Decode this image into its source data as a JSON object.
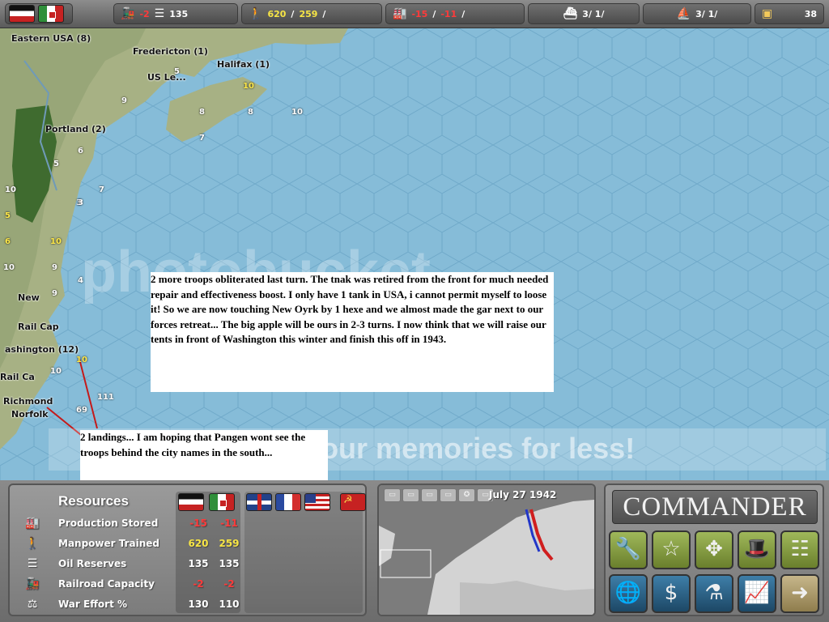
{
  "topbar": {
    "flags": [
      "germany-flag",
      "italy-flag"
    ],
    "railroad": {
      "icon": "train-icon",
      "value": "-2"
    },
    "oil": {
      "icon": "oil-barrels-icon",
      "value": "135"
    },
    "manpower": {
      "icon": "soldiers-icon",
      "axis": "620",
      "allies": "259",
      "sep": "/"
    },
    "production": {
      "icon": "factory-icon",
      "axis": "-15",
      "allies": "-11",
      "sep": "/"
    },
    "naval": {
      "icon": "battleship-icon",
      "text": "3/ 1/"
    },
    "transport": {
      "icon": "transport-ship-icon",
      "text": "3/ 1/"
    },
    "gold": {
      "icon": "treasure-chest-icon",
      "value": "38"
    }
  },
  "map": {
    "cities": [
      {
        "name": "Eastern USA (8)"
      },
      {
        "name": "Fredericton (1)"
      },
      {
        "name": "US Le..."
      },
      {
        "name": "Halifax (1)"
      },
      {
        "name": "Portland (2)"
      },
      {
        "name": "New"
      },
      {
        "name": "Rail Cap"
      },
      {
        "name": "ashington (12)"
      },
      {
        "name": "Rail Ca"
      },
      {
        "name": "Richmond"
      },
      {
        "name": "Norfolk"
      }
    ],
    "unit_numbers": [
      "9",
      "5",
      "10",
      "8",
      "7",
      "8",
      "6",
      "5",
      "7",
      "3",
      "10",
      "5",
      "10",
      "6",
      "9",
      "10",
      "10",
      "4",
      "9",
      "10",
      "10",
      "111",
      "69",
      "3"
    ],
    "watermark": "photobucket",
    "watermark_slogan": "Protect more of your memories for less!"
  },
  "notes": {
    "main": "2 more troops obliterated last turn. The tnak was retired from the front for much needed repair and effectiveness boost. I only have 1 tank in USA, i cannot permit myself to loose it! So we are now touching New Oyrk by 1 hexe and we almost made the gar next to our forces retreat... The big apple will be ours in 2-3 turns. I now think that we will raise our tents in front of Washington this winter and finish this off in 1943.",
    "landing": "2 landings... I am hoping that Pangen wont see the troops behind the city names in the south..."
  },
  "resources": {
    "title": "Resources",
    "flags": [
      "germany-flag",
      "italy-flag",
      "uk-flag",
      "france-flag",
      "usa-flag",
      "ussr-flag"
    ],
    "rows": [
      {
        "icon": "factory-icon",
        "label": "Production Stored",
        "values": [
          "-15",
          "-11"
        ]
      },
      {
        "icon": "soldiers-icon",
        "label": "Manpower Trained",
        "values": [
          "620",
          "259"
        ]
      },
      {
        "icon": "oil-barrels-icon",
        "label": "Oil Reserves",
        "values": [
          "135",
          "135"
        ]
      },
      {
        "icon": "train-icon",
        "label": "Railroad Capacity",
        "values": [
          "-2",
          "-2"
        ]
      },
      {
        "icon": "scales-icon",
        "label": "War Effort %",
        "values": [
          "130",
          "110"
        ]
      }
    ]
  },
  "minimap": {
    "date": "July 27 1942",
    "tabs": [
      "tab-land",
      "tab-air",
      "tab-sea",
      "tab-supply",
      "tab-star",
      "tab-options"
    ]
  },
  "commander": {
    "title": "COMMANDER",
    "buttons": [
      {
        "name": "repair-button",
        "icon": "wrench-icon"
      },
      {
        "name": "promote-button",
        "icon": "star-icon"
      },
      {
        "name": "move-button",
        "icon": "move-arrows-icon"
      },
      {
        "name": "diplomacy-button",
        "icon": "top-hat-icon"
      },
      {
        "name": "list-button",
        "icon": "list-icon"
      },
      {
        "name": "globe-button",
        "icon": "globe-icon"
      },
      {
        "name": "economy-button",
        "icon": "dollar-icon"
      },
      {
        "name": "research-button",
        "icon": "flask-icon"
      },
      {
        "name": "chart-button",
        "icon": "chart-icon"
      },
      {
        "name": "end-turn-button",
        "icon": "arrow-right-icon"
      }
    ]
  }
}
